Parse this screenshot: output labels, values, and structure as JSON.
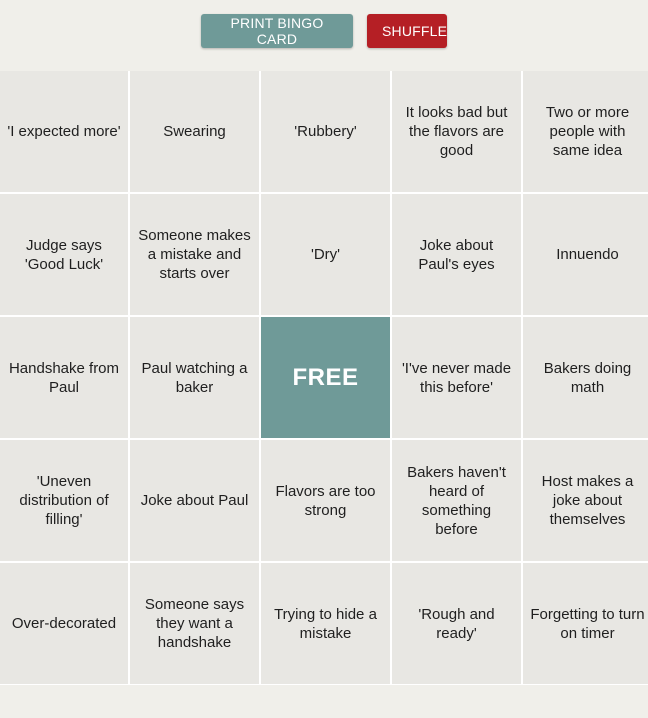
{
  "colors": {
    "print_button": "#6f9a98",
    "shuffle_button": "#b51f25",
    "free_cell": "#6f9a98",
    "cell_bg": "#e8e7e3",
    "page_bg": "#f0efea"
  },
  "toolbar": {
    "print_label": "PRINT BINGO CARD",
    "shuffle_label": "SHUFFLE"
  },
  "board": {
    "cells": [
      "'I expected more'",
      "Swearing",
      "'Rubbery'",
      "It looks bad but the flavors are good",
      "Two or more people with same idea",
      "Judge says 'Good Luck'",
      "Someone makes a mistake and starts over",
      "'Dry'",
      "Joke about Paul's eyes",
      "Innuendo",
      "Handshake from Paul",
      "Paul watching a baker",
      "FREE",
      "'I've never made this before'",
      "Bakers doing math",
      "'Uneven distribution of filling'",
      "Joke about Paul",
      "Flavors are too strong",
      "Bakers haven't heard of something before",
      "Host makes a joke about themselves",
      "Over-decorated",
      "Someone says they want a handshake",
      "Trying to hide a mistake",
      "'Rough and ready'",
      "Forgetting to turn on timer"
    ]
  }
}
